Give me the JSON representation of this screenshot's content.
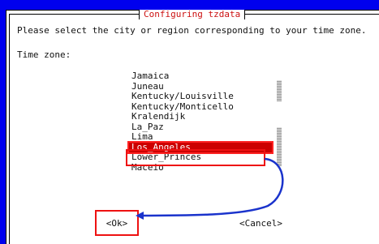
{
  "dialog": {
    "title": "Configuring tzdata",
    "prompt": "Please select the city or region corresponding to your time zone.",
    "field_label": "Time zone:"
  },
  "timezones": {
    "items": [
      "Jamaica",
      "Juneau",
      "Kentucky/Louisville",
      "Kentucky/Monticello",
      "Kralendijk",
      "La_Paz",
      "Lima",
      "Los_Angeles",
      "Lower_Princes",
      "Maceio"
    ],
    "selected": "Los_Angeles"
  },
  "buttons": {
    "ok": "<Ok>",
    "cancel": "<Cancel>"
  },
  "colors": {
    "background": "#0000ee",
    "dialog": "#ffffff",
    "title_text": "#cc1111",
    "selection": "#cc0000",
    "annotation_red": "#ee1111",
    "annotation_arrow": "#1a33cc"
  }
}
